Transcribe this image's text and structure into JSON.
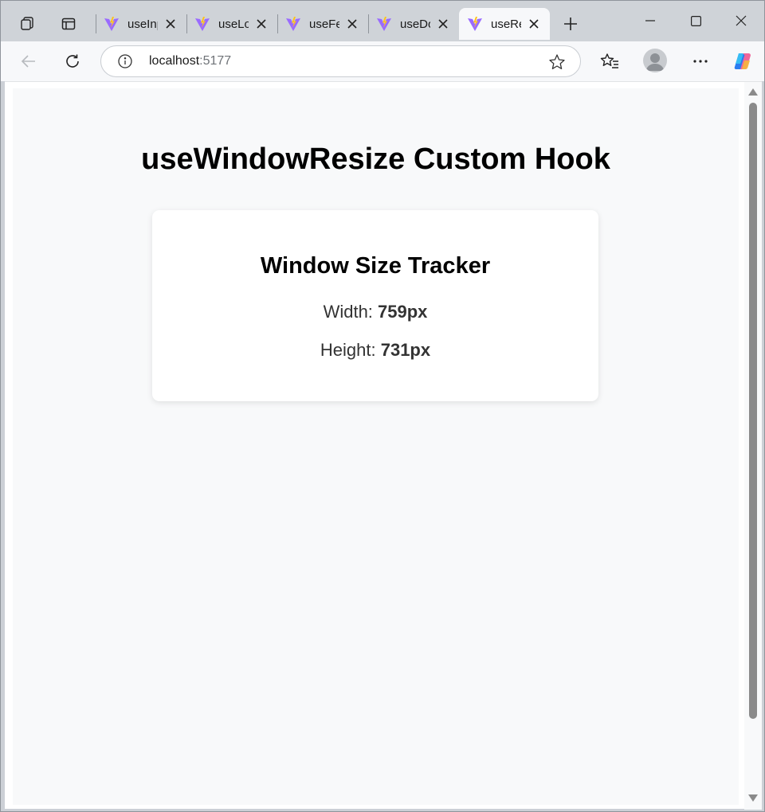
{
  "browser": {
    "tabs": [
      {
        "label": "useInput"
      },
      {
        "label": "useLocalStorage"
      },
      {
        "label": "useFetch"
      },
      {
        "label": "useDocumentTitle"
      },
      {
        "label": "useResize"
      }
    ],
    "address": {
      "host": "localhost",
      "port": ":5177"
    }
  },
  "page": {
    "title": "useWindowResize Custom Hook",
    "card": {
      "heading": "Window Size Tracker",
      "width_label": "Width: ",
      "width_value": "759px",
      "height_label": "Height: ",
      "height_value": "731px"
    }
  },
  "icons": {
    "workspaces": "workspaces-icon",
    "vertical_tabs": "vertical-tabs-icon",
    "vite": "vite-logo-icon",
    "close": "close-icon",
    "new_tab": "plus-icon",
    "back": "back-arrow-icon",
    "refresh": "refresh-icon",
    "info": "info-icon",
    "favorite": "star-icon",
    "favorites": "favorites-icon",
    "profile": "profile-icon",
    "more": "more-icon",
    "copilot": "copilot-icon"
  },
  "colors": {
    "page_bg": "#f8f9fa",
    "card_bg": "#ffffff",
    "tabstrip_bg": "#cfd3d8"
  }
}
